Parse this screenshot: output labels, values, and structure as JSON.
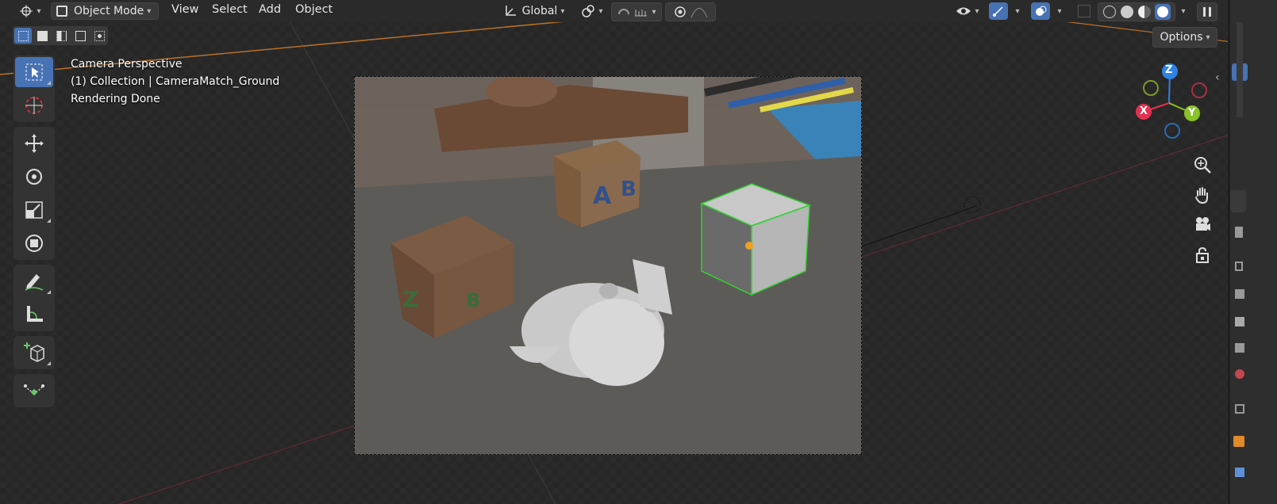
{
  "header": {
    "editor_icon": "cursor-3d-icon",
    "mode": "Object Mode",
    "menus": [
      "View",
      "Select",
      "Add",
      "Object"
    ],
    "transform_orientation": "Global",
    "pivot_icon": "pivot-icon",
    "snap_icon": "snap-magnet-icon",
    "proportional_icon": "proportional-edit-icon",
    "visibility_icon": "eye-icon",
    "gizmo_icon": "gizmo-icon",
    "overlay_icon": "overlay-icon",
    "shading_modes": [
      "wireframe",
      "solid",
      "material",
      "rendered"
    ],
    "active_shading": "rendered"
  },
  "options_label": "Options",
  "viewport_overlay": {
    "line1": "Camera Perspective",
    "line2": "(1) Collection | CameraMatch_Ground",
    "line3": "Rendering Done"
  },
  "toolbar": {
    "tools": [
      {
        "name": "select-box",
        "icon": "cursor-arrow-icon",
        "active": true
      },
      {
        "name": "cursor",
        "icon": "cursor-3d-icon",
        "active": false
      },
      {
        "name": "move",
        "icon": "move-icon",
        "active": false
      },
      {
        "name": "rotate",
        "icon": "rotate-icon",
        "active": false
      },
      {
        "name": "scale",
        "icon": "scale-icon",
        "active": false
      },
      {
        "name": "transform",
        "icon": "transform-icon",
        "active": false
      },
      {
        "name": "annotate",
        "icon": "pencil-icon",
        "active": false
      },
      {
        "name": "measure",
        "icon": "ruler-icon",
        "active": false
      },
      {
        "name": "add-cube",
        "icon": "add-cube-icon",
        "active": false
      },
      {
        "name": "shear",
        "icon": "shear-icon",
        "active": false
      }
    ]
  },
  "nav_gizmo": {
    "axes": [
      {
        "label": "Z",
        "color": "#2f83e3"
      },
      {
        "label": "Y",
        "color": "#88c425"
      },
      {
        "label": "X",
        "color": "#e33250"
      }
    ]
  },
  "view_buttons": [
    "zoom-icon",
    "hand-pan-icon",
    "camera-icon",
    "lock-icon"
  ],
  "colors": {
    "accent": "#4772b3",
    "header_bg": "#2a2a2a",
    "selection_outline": "#2fd12f"
  }
}
